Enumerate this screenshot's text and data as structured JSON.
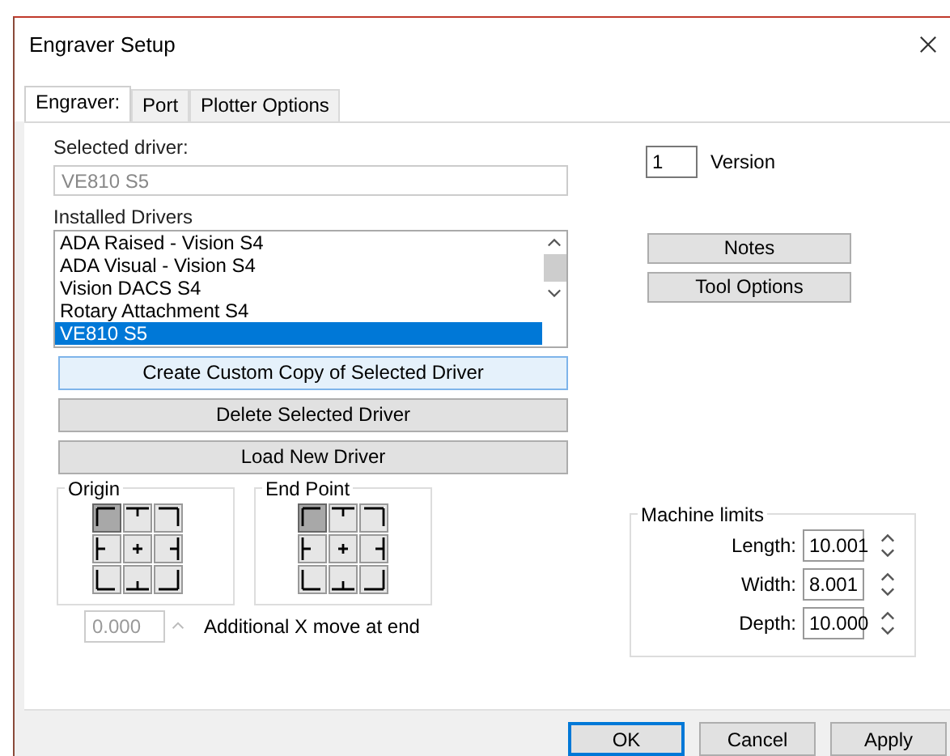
{
  "window": {
    "title": "Engraver Setup"
  },
  "tabs": [
    {
      "label": "Engraver:",
      "selected": true
    },
    {
      "label": "Port",
      "selected": false
    },
    {
      "label": "Plotter Options",
      "selected": false
    }
  ],
  "selected_driver": {
    "label": "Selected driver:",
    "value": "VE810 S5",
    "disabled": true
  },
  "installed_drivers": {
    "label": "Installed Drivers",
    "items": [
      {
        "label": "ADA Raised - Vision S4",
        "selected": false
      },
      {
        "label": "ADA Visual - Vision S4",
        "selected": false
      },
      {
        "label": "Vision DACS S4",
        "selected": false
      },
      {
        "label": "Rotary Attachment S4",
        "selected": false
      },
      {
        "label": "VE810 S5",
        "selected": true
      }
    ]
  },
  "driver_buttons": [
    {
      "label": "Create Custom Copy of Selected Driver",
      "focused": true
    },
    {
      "label": "Delete Selected Driver",
      "focused": false
    },
    {
      "label": "Load New Driver",
      "focused": false
    }
  ],
  "origin": {
    "title": "Origin",
    "cells": [
      {
        "kind": "tl",
        "selected": true
      },
      {
        "kind": "t",
        "selected": false
      },
      {
        "kind": "tr",
        "selected": false
      },
      {
        "kind": "l",
        "selected": false
      },
      {
        "kind": "c",
        "selected": false
      },
      {
        "kind": "r",
        "selected": false
      },
      {
        "kind": "bl",
        "selected": false
      },
      {
        "kind": "b",
        "selected": false
      },
      {
        "kind": "br",
        "selected": false
      }
    ]
  },
  "end_point": {
    "title": "End Point",
    "cells": [
      {
        "kind": "tl",
        "selected": true
      },
      {
        "kind": "t",
        "selected": false
      },
      {
        "kind": "tr",
        "selected": false
      },
      {
        "kind": "l",
        "selected": false
      },
      {
        "kind": "c",
        "selected": false
      },
      {
        "kind": "r",
        "selected": false
      },
      {
        "kind": "bl",
        "selected": false
      },
      {
        "kind": "b",
        "selected": false
      },
      {
        "kind": "br",
        "selected": false
      }
    ]
  },
  "additional_x": {
    "value": "0.000",
    "label": "Additional X move at end",
    "disabled": true
  },
  "version": {
    "value": "1",
    "label": "Version"
  },
  "side_buttons": [
    "Notes",
    "Tool Options"
  ],
  "machine_limits": {
    "title": "Machine limits",
    "fields": [
      {
        "label": "Length:",
        "value": "10.001"
      },
      {
        "label": "Width:",
        "value": "8.001"
      },
      {
        "label": "Depth:",
        "value": "10.000"
      }
    ]
  },
  "dialog_buttons": [
    {
      "label": "OK",
      "default": true
    },
    {
      "label": "Cancel",
      "default": false
    },
    {
      "label": "Apply",
      "default": false
    }
  ]
}
